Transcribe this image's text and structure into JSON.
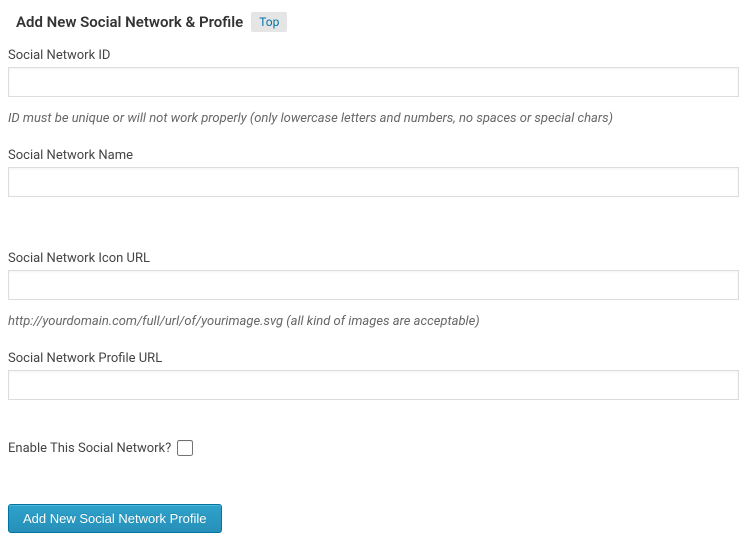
{
  "header": {
    "title": "Add New Social Network & Profile",
    "top_link": "Top"
  },
  "fields": {
    "id": {
      "label": "Social Network ID",
      "value": "",
      "hint": "ID must be unique or will not work properly (only lowercase letters and numbers, no spaces or special chars)"
    },
    "name": {
      "label": "Social Network Name",
      "value": ""
    },
    "icon_url": {
      "label": "Social Network Icon URL",
      "value": "",
      "hint": "http://yourdomain.com/full/url/of/yourimage.svg (all kind of images are acceptable)"
    },
    "profile_url": {
      "label": "Social Network Profile URL",
      "value": ""
    },
    "enable": {
      "label": "Enable This Social Network?",
      "checked": false
    }
  },
  "submit_label": "Add New Social Network Profile"
}
